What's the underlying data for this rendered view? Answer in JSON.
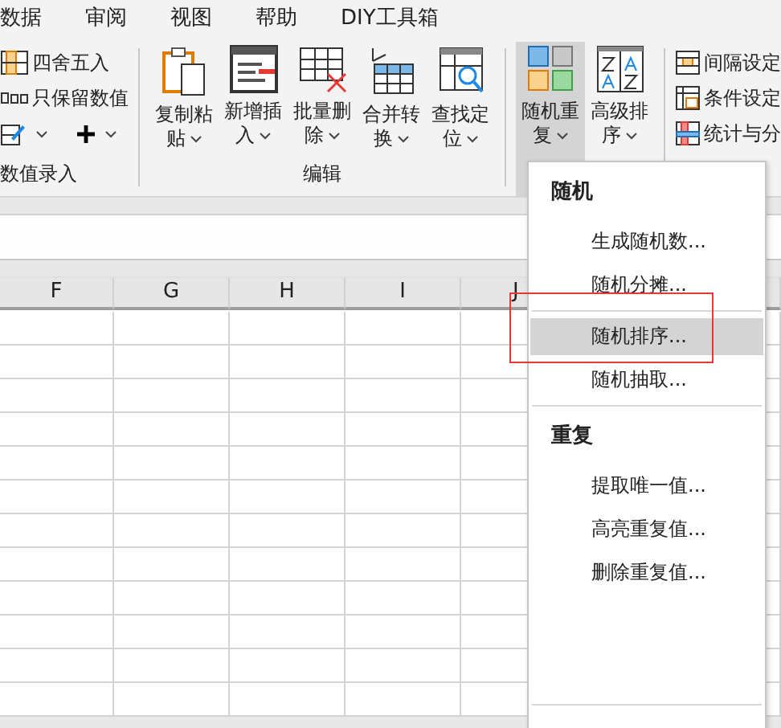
{
  "tabs": [
    {
      "label": "数据",
      "selected": false
    },
    {
      "label": "审阅",
      "selected": false
    },
    {
      "label": "视图",
      "selected": false
    },
    {
      "label": "帮助",
      "selected": false
    },
    {
      "label": "DIY工具箱",
      "selected": false
    }
  ],
  "ribbon": {
    "groups": [
      {
        "label": "数值录入",
        "kind": "small",
        "items": [
          {
            "label": "四舍五入"
          },
          {
            "label": "只保留数值"
          }
        ]
      },
      {
        "label": "编辑",
        "kind": "large",
        "buttons": [
          {
            "label": "复制粘贴",
            "expanded": false
          },
          {
            "label": "新增插入",
            "expanded": false
          },
          {
            "label": "批量删除",
            "expanded": false
          },
          {
            "label": "合并转换",
            "expanded": false
          },
          {
            "label": "查找定位",
            "expanded": false
          }
        ]
      },
      {
        "kind": "large",
        "buttons": [
          {
            "label": "随机重复",
            "expanded": true
          },
          {
            "label": "高级排序",
            "expanded": false
          }
        ]
      },
      {
        "kind": "small",
        "items": [
          {
            "label": "间隔设定"
          },
          {
            "label": "条件设定"
          },
          {
            "label": "统计与分"
          }
        ]
      }
    ]
  },
  "sheet": {
    "columns": [
      "F",
      "G",
      "H",
      "I",
      "J"
    ]
  },
  "menu": {
    "items": [
      {
        "kind": "header",
        "label": "随机"
      },
      {
        "kind": "item",
        "label": "生成随机数...",
        "selected": false,
        "marked": false
      },
      {
        "kind": "item",
        "label": "随机分摊...",
        "selected": false,
        "marked": false
      },
      {
        "kind": "separator"
      },
      {
        "kind": "item",
        "label": "随机排序...",
        "selected": true,
        "marked": true
      },
      {
        "kind": "item",
        "label": "随机抽取...",
        "selected": false,
        "marked": false
      },
      {
        "kind": "separator"
      },
      {
        "kind": "header",
        "label": "重复"
      },
      {
        "kind": "item",
        "label": "提取唯一值...",
        "selected": false,
        "marked": false
      },
      {
        "kind": "item",
        "label": "高亮重复值...",
        "selected": false,
        "marked": false
      },
      {
        "kind": "item",
        "label": "删除重复值...",
        "selected": false,
        "marked": false
      },
      {
        "kind": "spacer"
      },
      {
        "kind": "separator"
      }
    ]
  }
}
